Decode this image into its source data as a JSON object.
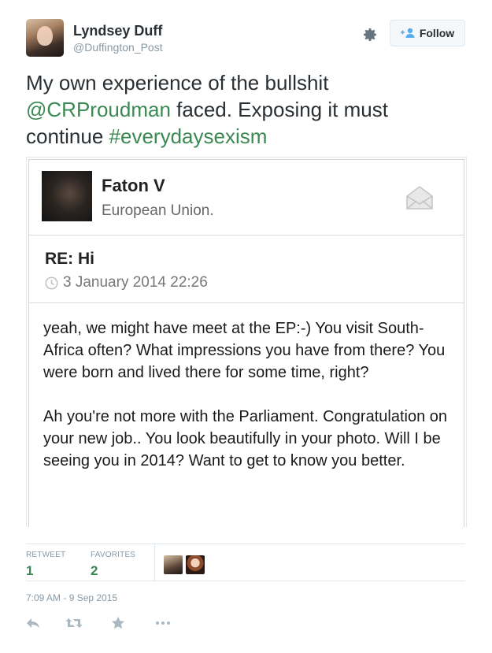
{
  "author": {
    "name": "Lyndsey Duff",
    "handle": "@Duffington_Post",
    "avatar_icon": "profile-photo"
  },
  "header": {
    "gear_icon": "gear-icon",
    "follow_label": "Follow"
  },
  "tweet": {
    "text_before": "My own experience of the bullshit ",
    "mention": "@CRProudman",
    "text_middle": " faced. Exposing it must continue ",
    "hashtag": "#everydaysexism"
  },
  "card": {
    "sender_name": "Faton V",
    "sender_org": "European Union.",
    "subject": "RE: Hi",
    "date": "3 January 2014 22:26",
    "body": "yeah, we might have meet at the EP:-) You visit South-Africa often? What impressions you have from there? You were born and lived there for some time, right?\n\nAh you're not more with the Parliament. Congratulation on your new job.. You look beautifully in your photo. Will I be seeing you in 2014? Want to get to know you better."
  },
  "stats": {
    "retweet_label": "RETWEET",
    "retweet_count": "1",
    "favorites_label": "FAVORITES",
    "favorites_count": "2"
  },
  "meta": {
    "datetime": "7:09 AM - 9 Sep 2015"
  },
  "colors": {
    "link": "#3b8952",
    "meta_text": "#8899a6",
    "border": "#e1e8ed"
  }
}
